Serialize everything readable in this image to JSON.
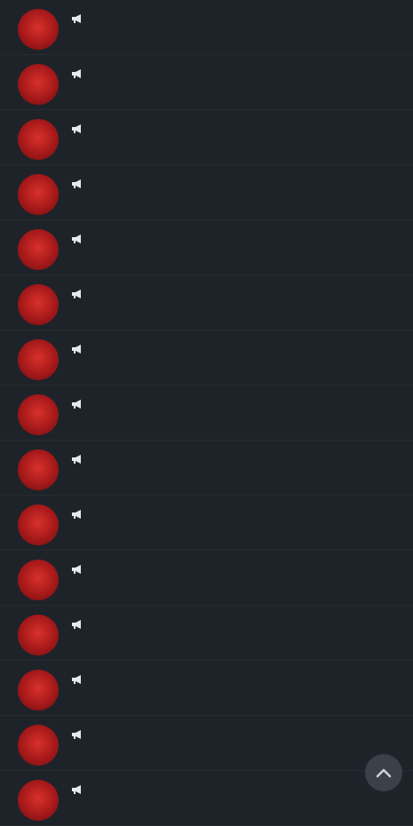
{
  "colors": {
    "background": "#1e2329",
    "name_text": "#f0f2f4",
    "preview_text": "#8b949c",
    "date_text": "#7d8790",
    "scroll_button": "#3a4149"
  },
  "icons": {
    "row_avatar": "avatar-image",
    "row_type": "channel-megaphone-icon",
    "scroll_button": "chevron-up-icon"
  },
  "chats": [
    {
      "name": "",
      "date": "",
      "preview": ""
    },
    {
      "name": "",
      "date": "",
      "preview": ""
    },
    {
      "name": "",
      "date": "",
      "preview": ""
    },
    {
      "name": "",
      "date": "",
      "preview": ""
    },
    {
      "name": "",
      "date": "",
      "preview": ""
    },
    {
      "name": "",
      "date": "",
      "preview": ""
    },
    {
      "name": "",
      "date": "",
      "preview": ""
    },
    {
      "name": "",
      "date": "",
      "preview": ""
    },
    {
      "name": "",
      "date": "",
      "preview": ""
    },
    {
      "name": "",
      "date": "",
      "preview": ""
    },
    {
      "name": "",
      "date": "",
      "preview": ""
    },
    {
      "name": "",
      "date": "",
      "preview": ""
    },
    {
      "name": "",
      "date": "",
      "preview": ""
    },
    {
      "name": "",
      "date": "",
      "preview": ""
    },
    {
      "name": "",
      "date": "",
      "preview": ""
    }
  ]
}
